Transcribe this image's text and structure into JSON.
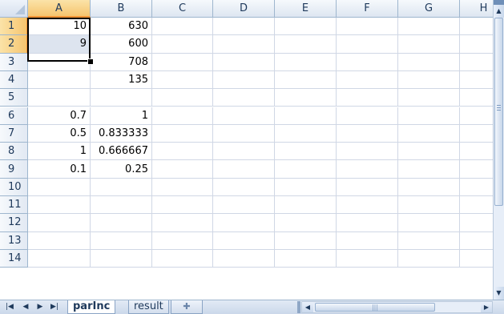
{
  "columns": [
    "A",
    "B",
    "C",
    "D",
    "E",
    "F",
    "G",
    "H"
  ],
  "rows": [
    "1",
    "2",
    "3",
    "4",
    "5",
    "6",
    "7",
    "8",
    "9",
    "10",
    "11",
    "12",
    "13",
    "14"
  ],
  "cells": {
    "A1": "10",
    "B1": "630",
    "A2": "9",
    "B2": "600",
    "B3": "708",
    "B4": "135",
    "A6": "0.7",
    "B6": "1",
    "A7": "0.5",
    "B7": "0.833333",
    "A8": "1",
    "B8": "0.666667",
    "A9": "0.1",
    "B9": "0.25"
  },
  "selection": {
    "range": "A1:A2",
    "active_cell": "A1"
  },
  "sheet_tabs": [
    {
      "label": "parInc",
      "active": true
    },
    {
      "label": "result",
      "active": false
    }
  ],
  "nav_buttons": [
    "first-sheet",
    "previous-sheet",
    "next-sheet",
    "last-sheet"
  ],
  "icons": {
    "new_sheet": "insert-worksheet-icon",
    "scroll_up": "scroll-up-arrow-icon",
    "scroll_down": "scroll-down-arrow-icon",
    "scroll_left": "scroll-left-arrow-icon",
    "scroll_right": "scroll-right-arrow-icon"
  },
  "colors": {
    "header_selected": "#f6c56f",
    "selection_fill": "#dde4ef",
    "gridline": "#d0d7e5",
    "header_text": "#1e395b"
  }
}
